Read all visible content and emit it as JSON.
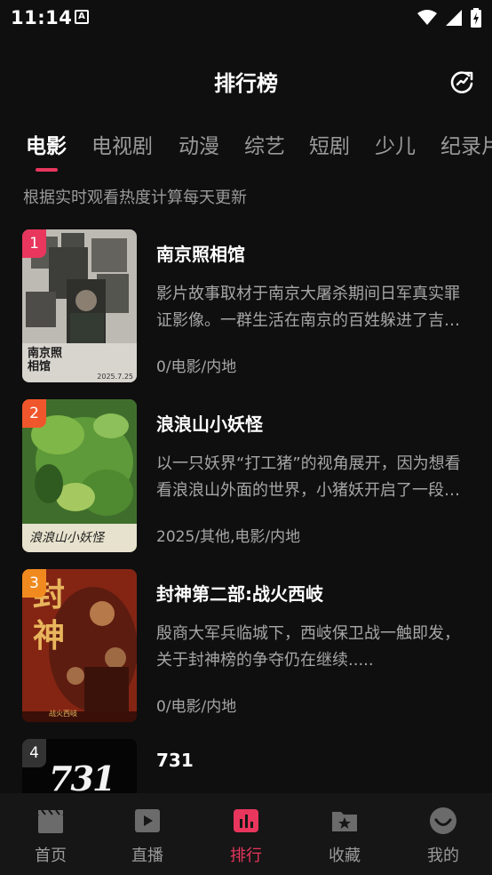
{
  "status_bar": {
    "time": "11:14",
    "notification_letter": "A"
  },
  "header": {
    "title": "排行榜"
  },
  "tabs": [
    {
      "label": "电影",
      "active": true
    },
    {
      "label": "电视剧",
      "active": false
    },
    {
      "label": "动漫",
      "active": false
    },
    {
      "label": "综艺",
      "active": false
    },
    {
      "label": "短剧",
      "active": false
    },
    {
      "label": "少儿",
      "active": false
    },
    {
      "label": "纪录片",
      "active": false
    }
  ],
  "subtitle": "根据实时观看热度计算每天更新",
  "rank_colors": {
    "1": "#e8365d",
    "2": "#f0562b",
    "3": "#f08a1f",
    "default": "#333333"
  },
  "items": [
    {
      "rank": "1",
      "title": "南京照相馆",
      "desc": "影片故事取材于南京大屠杀期间日军真实罪证影像。一群生活在南京的百姓躲进了吉祥照相馆",
      "meta": "0/电影/内地",
      "poster_text": "南京照相馆",
      "poster_caption": "2025.7.25"
    },
    {
      "rank": "2",
      "title": "浪浪山小妖怪",
      "desc": "以一只妖界“打工猪”的视角展开，因为想看看浪浪山外面的世界，小猪妖开启了一段冒险",
      "meta": "2025/其他,电影/内地",
      "poster_text": "浪浪山小妖怪"
    },
    {
      "rank": "3",
      "title": "封神第二部:战火西岐",
      "desc": "殷商大军兵临城下，西岐保卫战一触即发，关于封神榜的争夺仍在继续.....",
      "meta": "0/电影/内地",
      "poster_text": "封神",
      "poster_caption": "战火西岐"
    },
    {
      "rank": "4",
      "title": "731",
      "desc": "",
      "meta": "",
      "poster_text": "731"
    }
  ],
  "bottom_nav": [
    {
      "label": "首页",
      "icon": "clapperboard-icon",
      "active": false
    },
    {
      "label": "直播",
      "icon": "play-icon",
      "active": false
    },
    {
      "label": "排行",
      "icon": "ranking-chart-icon",
      "active": true
    },
    {
      "label": "收藏",
      "icon": "star-folder-icon",
      "active": false
    },
    {
      "label": "我的",
      "icon": "smile-profile-icon",
      "active": false
    }
  ],
  "colors": {
    "accent": "#e8365d",
    "background": "#0f0f0f",
    "muted_text": "#9a9a9a"
  }
}
